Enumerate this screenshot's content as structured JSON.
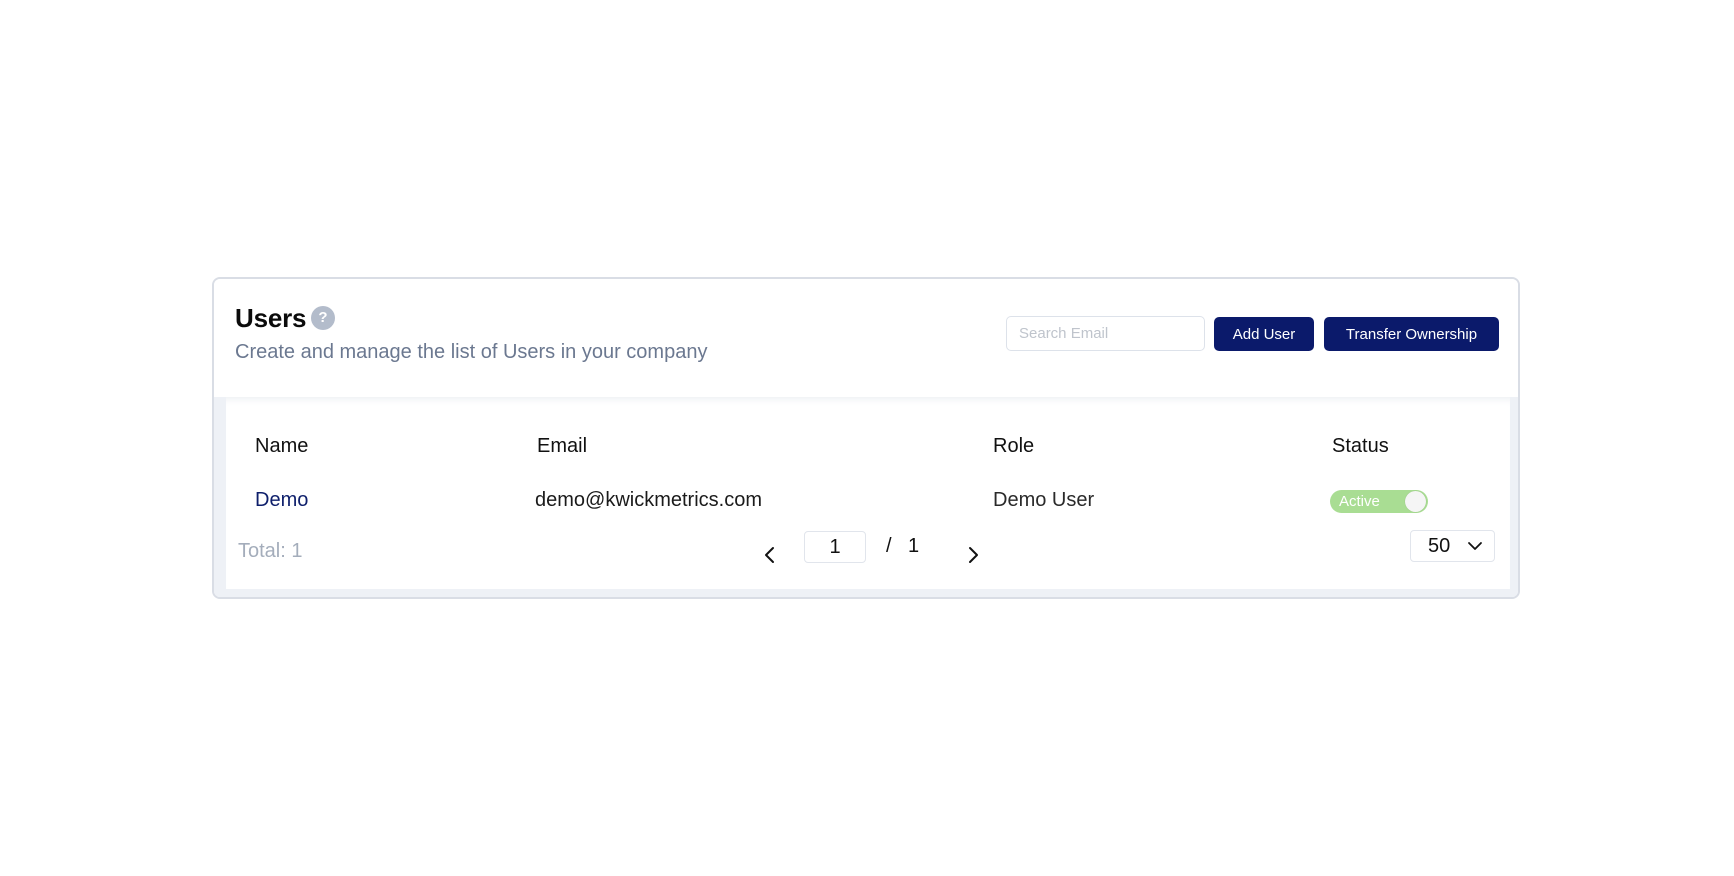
{
  "header": {
    "title": "Users",
    "help_icon": "question-mark-icon",
    "subtitle": "Create and manage the list of Users in your company"
  },
  "toolbar": {
    "search_placeholder": "Search Email",
    "search_value": "",
    "add_user_label": "Add User",
    "transfer_ownership_label": "Transfer Ownership"
  },
  "table": {
    "columns": [
      "Name",
      "Email",
      "Role",
      "Status"
    ],
    "rows": [
      {
        "name": "Demo",
        "email": "demo@kwickmetrics.com",
        "role": "Demo User",
        "status": "Active",
        "status_on": true
      }
    ]
  },
  "footer": {
    "total_label": "Total: 1",
    "current_page": "1",
    "page_separator": "/",
    "total_pages": "1",
    "per_page": "50",
    "prev_icon": "chevron-left-icon",
    "next_icon": "chevron-right-icon"
  },
  "colors": {
    "primary": "#0b1a6b",
    "active_toggle": "#a9dd93",
    "subtitle": "#6b7890",
    "help_icon": "#b3bccb"
  }
}
